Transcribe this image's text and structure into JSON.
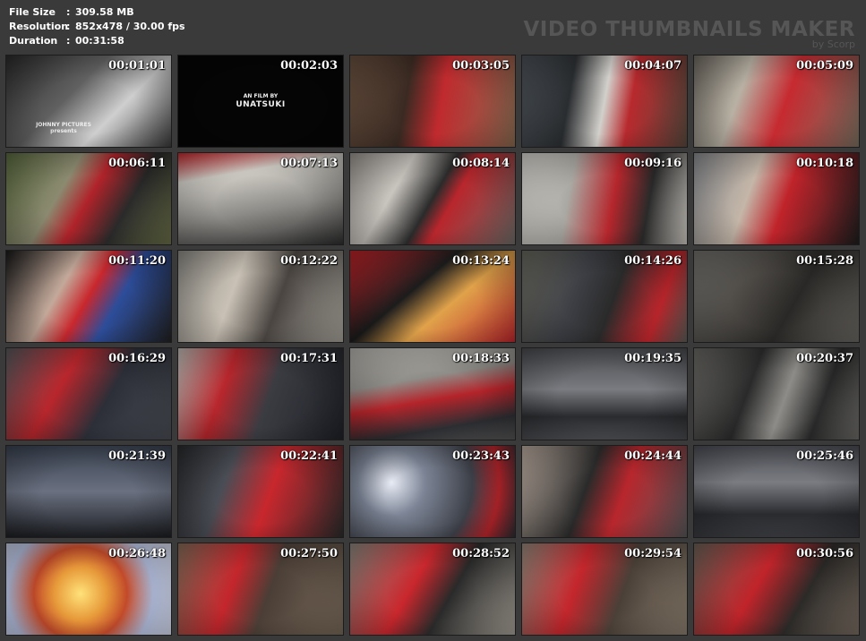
{
  "info": {
    "file_size_label": "File Size",
    "file_size_value": "309.58 MB",
    "resolution_label": "Resolution",
    "resolution_value": "852x478 / 30.00 fps",
    "duration_label": "Duration",
    "duration_value": "00:31:58",
    "separator": ":"
  },
  "brand": {
    "title": "VIDEO THUMBNAILS MAKER",
    "subtitle": "by Scorp"
  },
  "thumbnails": [
    {
      "time": "00:01:01",
      "credit_line1": "JOHNNY PICTURES",
      "credit_line2": "presents",
      "bg": "linear-gradient(135deg,#2b2b2b 0%,#606060 40%,#cfcfcf 65%,#3a3a3a 100%)"
    },
    {
      "time": "00:02:03",
      "credit_line1": "AN FILM BY",
      "credit_line2": "UNATSUKI",
      "bg": "#050505"
    },
    {
      "time": "00:03:05",
      "bg": "linear-gradient(100deg,#6a5140 0%,#3a2a22 35%,#c02a2e 55%,#8a6a50 100%)"
    },
    {
      "time": "00:04:07",
      "bg": "linear-gradient(100deg,#4d5359 0%,#2a2d30 30%,#d2d0cb 50%,#b8292d 65%,#5a4a3e 100%)"
    },
    {
      "time": "00:05:09",
      "bg": "linear-gradient(110deg,#6f6a62 0%,#b8b1a4 30%,#c62a30 55%,#7c7060 100%)"
    },
    {
      "time": "00:06:11",
      "bg": "linear-gradient(120deg,#5b6b40 0%,#8b8a70 35%,#b0232a 50%,#2a2a2a 70%,#6b7048 100%)"
    },
    {
      "time": "00:07:13",
      "bg": "linear-gradient(170deg,#c82a30 0%,#d0cdc6 25%,#8d8b87 60%,#2e2e2e 100%)"
    },
    {
      "time": "00:08:14",
      "bg": "linear-gradient(120deg,#9a9690 0%,#c8c4be 30%,#2b2b2b 50%,#b8262c 60%,#6f6c67 100%)"
    },
    {
      "time": "00:09:16",
      "bg": "linear-gradient(100deg,#dcdad4 0%,#aaa8a2 30%,#b5262c 55%,#2a2a2a 75%,#cfcbc4 100%)"
    },
    {
      "time": "00:10:18",
      "bg": "linear-gradient(110deg,#8b8e92 0%,#c4b6a8 35%,#c0232a 55%,#1e1e1e 100%)"
    },
    {
      "time": "00:11:20",
      "bg": "linear-gradient(120deg,#1a1a1a 0%,#c3a99a 35%,#c9272d 50%,#2d4d9a 65%,#222 100%)"
    },
    {
      "time": "00:12:22",
      "bg": "linear-gradient(110deg,#8e8c86 0%,#c9c1b5 35%,#4a4541 60%,#a8a49c 100%)"
    },
    {
      "time": "00:13:24",
      "bg": "linear-gradient(140deg,#c0242a 0%,#1c1c1c 40%,#e0a24a 60%,#c0272d 100%)"
    },
    {
      "time": "00:14:26",
      "bg": "linear-gradient(110deg,#6a6a60 0%,#3d3f45 35%,#2a2a2a 55%,#c0262c 80%,#5d5e58 100%)"
    },
    {
      "time": "00:15:28",
      "bg": "linear-gradient(120deg,#75736e 0%,#4b4844 35%,#2a2826 60%,#6b6862 100%)"
    },
    {
      "time": "00:16:29",
      "bg": "linear-gradient(120deg,#585a5e 0%,#b8262c 35%,#2c2f38 60%,#4a4d55 100%)"
    },
    {
      "time": "00:17:31",
      "bg": "linear-gradient(110deg,#c7c4be 0%,#b8262c 30%,#3a3c42 55%,#1f2128 100%)"
    },
    {
      "time": "00:18:33",
      "bg": "linear-gradient(170deg,#bdbab4 0%,#8f8d88 35%,#b4242a 55%,#2d2e32 80%,#555 100%)"
    },
    {
      "time": "00:19:35",
      "bg": "linear-gradient(180deg,#4a4b4f 0%,#7a7b80 45%,#2a2b2e 75%,#4a4b4f 100%)"
    },
    {
      "time": "00:20:37",
      "bg": "linear-gradient(110deg,#6d6c68 0%,#2a2a2a 35%,#8d8c88 55%,#2a2a2a 75%,#6d6c68 100%)"
    },
    {
      "time": "00:21:39",
      "bg": "linear-gradient(180deg,#3a4250 0%,#6a7080 50%,#1c1e22 100%)"
    },
    {
      "time": "00:22:41",
      "bg": "linear-gradient(110deg,#2a2b2e 0%,#4a4d55 30%,#c8272d 55%,#2c2c2c 100%)"
    },
    {
      "time": "00:23:43",
      "bg": "radial-gradient(circle at 25% 40%,#e8ecf5 0%,#7c8495 25%,#3c3f47 60%,#b4242a 80%,#2b2d33 100%)"
    },
    {
      "time": "00:24:44",
      "bg": "linear-gradient(110deg,#c2b2a6 0%,#2a2a2a 40%,#b8262c 60%,#58585a 100%)"
    },
    {
      "time": "00:25:46",
      "bg": "linear-gradient(180deg,#4c4e55 0%,#7a7c82 40%,#2a2b2f 75%,#3a3b40 100%)"
    },
    {
      "time": "00:26:48",
      "bg": "radial-gradient(circle at 45% 55%,#ffe27a 0%,#e79a3a 25%,#c24a2a 45%,#b5c0e0 70%,#dfe4f5 100%)"
    },
    {
      "time": "00:27:50",
      "bg": "linear-gradient(110deg,#8a6e5a 0%,#c4262c 35%,#4a3e36 55%,#7a6a5a 100%)"
    },
    {
      "time": "00:28:52",
      "bg": "linear-gradient(120deg,#8f8a80 0%,#c9272d 40%,#2a2a2a 60%,#a8a298 100%)"
    },
    {
      "time": "00:29:54",
      "bg": "linear-gradient(110deg,#9a8c7e 0%,#c4262c 35%,#4a4038 60%,#8e8070 100%)"
    },
    {
      "time": "00:30:56",
      "bg": "linear-gradient(120deg,#6e6358 0%,#c0242a 40%,#2c2a28 65%,#7a6e62 100%)"
    }
  ]
}
